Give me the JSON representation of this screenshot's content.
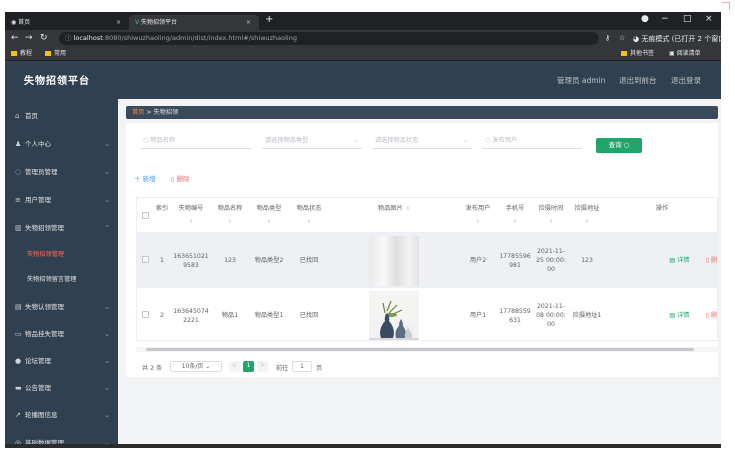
{
  "browser": {
    "tabs": [
      {
        "title": "首页"
      },
      {
        "title": "失物招领平台"
      }
    ],
    "url_host": "localhost",
    "url_rest": ":8080/shiwuzhaoling/admin/dist/index.html#/shiwuzhaoling",
    "incognito": "无痕模式 (已打开 2 个窗口)",
    "bookmarks": [
      "教程",
      "常用"
    ],
    "bookmarks_right": [
      "其他书签",
      "阅读清单"
    ]
  },
  "header": {
    "title": "失物招领平台",
    "user": "管理员 admin",
    "to_front": "退出到前台",
    "logout": "退出登录"
  },
  "sidebar": {
    "items": [
      {
        "label": "首页",
        "icon": "home-icon",
        "glyph": "⌂",
        "expand": false
      },
      {
        "label": "个人中心",
        "icon": "user-icon",
        "glyph": "♟",
        "expand": true
      },
      {
        "label": "管理员管理",
        "icon": "admin-icon",
        "glyph": "◌",
        "expand": true
      },
      {
        "label": "用户管理",
        "icon": "users-icon",
        "glyph": "≡",
        "expand": true
      },
      {
        "label": "失物招领管理",
        "icon": "lost-found-icon",
        "glyph": "▥",
        "expand": true,
        "open": true
      },
      {
        "label": "失物招领管理",
        "icon": "",
        "glyph": "",
        "sub": true,
        "active": true
      },
      {
        "label": "失物招领留言管理",
        "icon": "",
        "glyph": "",
        "sub": true
      },
      {
        "label": "失物认领管理",
        "icon": "claim-icon",
        "glyph": "▤",
        "expand": true
      },
      {
        "label": "物品挂失管理",
        "icon": "report-loss-icon",
        "glyph": "▭",
        "expand": true
      },
      {
        "label": "论坛管理",
        "icon": "forum-icon",
        "glyph": "●",
        "expand": true
      },
      {
        "label": "公告管理",
        "icon": "notice-icon",
        "glyph": "▬",
        "expand": true
      },
      {
        "label": "轮播图信息",
        "icon": "carousel-icon",
        "glyph": "↗",
        "expand": true
      },
      {
        "label": "基础数据管理",
        "icon": "basic-data-icon",
        "glyph": "◎",
        "expand": true
      }
    ]
  },
  "breadcrumb": {
    "home": "首页",
    "current": "失物招领"
  },
  "search": {
    "name_placeholder": "物品名称",
    "type_placeholder": "请选择物品类型",
    "status_placeholder": "请选择物品状态",
    "user_placeholder": "发布用户",
    "button": "查询"
  },
  "toolbar": {
    "add": "新增",
    "delete": "删除"
  },
  "table": {
    "columns": [
      "索引",
      "失物编号",
      "物品名称",
      "物品类型",
      "物品状态",
      "物品图片",
      "发布用户",
      "手机号",
      "捡摄时间",
      "捡摄地址",
      "操作"
    ],
    "rows": [
      {
        "index": "1",
        "code": "1636510219583",
        "name": "123",
        "type": "物品类型2",
        "status": "已找回",
        "user": "用户2",
        "phone": "17785596981",
        "time": "2021-11-25 00:00:00",
        "addr": "123"
      },
      {
        "index": "2",
        "code": "1636450742221",
        "name": "物品1",
        "type": "物品类型1",
        "status": "已找回",
        "user": "用户1",
        "phone": "17788559631",
        "time": "2021-11-08 00:00:00",
        "addr": "捡摄地址1"
      }
    ],
    "detail": "详情",
    "del": "删"
  },
  "pagination": {
    "total": "共 2 条",
    "page_size": "10条/页",
    "page": "1",
    "goto": "前往",
    "goto_page": "1",
    "unit": "页"
  },
  "colors": {
    "sidebar": "#2f4050",
    "accent": "#ff6b57",
    "primary": "#409eff",
    "success": "#20a56a"
  }
}
